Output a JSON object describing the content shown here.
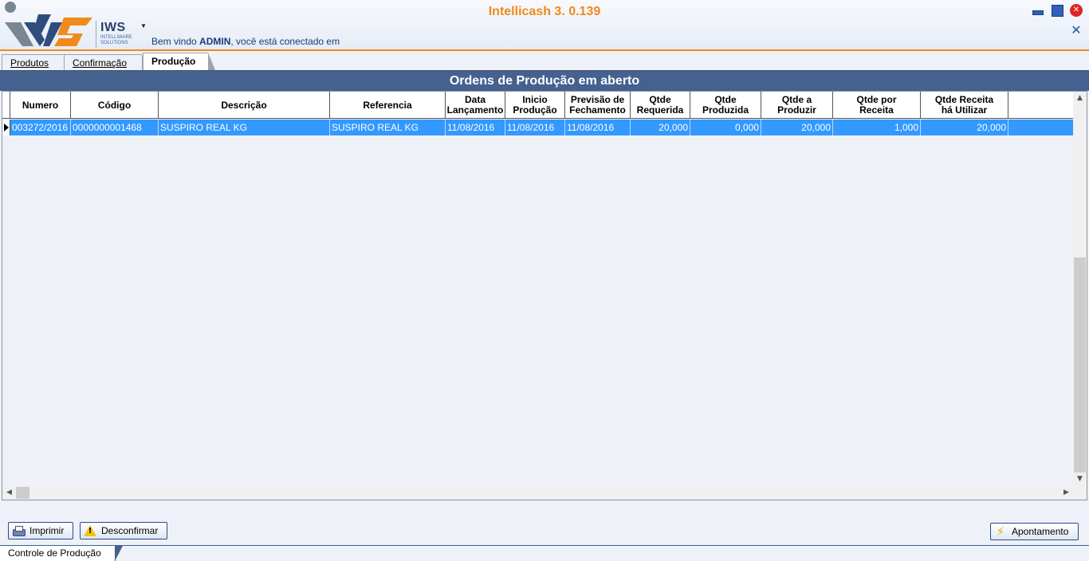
{
  "app": {
    "title": "Intellicash 3. 0.139",
    "logo_text": "IWS",
    "logo_subtext": "INTELLIWARE SOLUTIONS",
    "welcome_prefix": "Bem vindo ",
    "welcome_user": "ADMIN",
    "welcome_suffix": ", você está conectado em"
  },
  "tabs": [
    {
      "label": "Produtos",
      "active": false
    },
    {
      "label": "Confirmação",
      "active": false
    },
    {
      "label": "Produção",
      "active": true
    }
  ],
  "grid": {
    "title": "Ordens de Produção em  aberto",
    "columns": [
      "Numero",
      "Código",
      "Descrição",
      "Referencia",
      "Data\nLançamento",
      "Inicio\nProdução",
      "Previsão de\nFechamento",
      "Qtde\nRequerida",
      "Qtde Produzida",
      "Qtde a Produzir",
      "Qtde por\nReceita",
      "Qtde Receita\nhá Utilizar"
    ],
    "rows": [
      {
        "numero": "003272/2016",
        "codigo": "0000000001468",
        "descricao": "SUSPIRO REAL KG",
        "referencia": "SUSPIRO REAL KG",
        "data_lancamento": "11/08/2016",
        "inicio_producao": "11/08/2016",
        "previsao_fechamento": "11/08/2016",
        "qtde_requerida": "20,000",
        "qtde_produzida": "0,000",
        "qtde_a_produzir": "20,000",
        "qtde_por_receita": "1,000",
        "qtde_receita_utilizar": "20,000",
        "selected": true
      }
    ]
  },
  "buttons": {
    "imprimir": "Imprimir",
    "desconfirmar": "Desconfirmar",
    "apontamento": "Apontamento"
  },
  "bottom_tab": "Controle de Produção",
  "colors": {
    "accent_orange": "#ef8a1a",
    "header_blue": "#44618f",
    "selection_blue": "#3399ff"
  }
}
